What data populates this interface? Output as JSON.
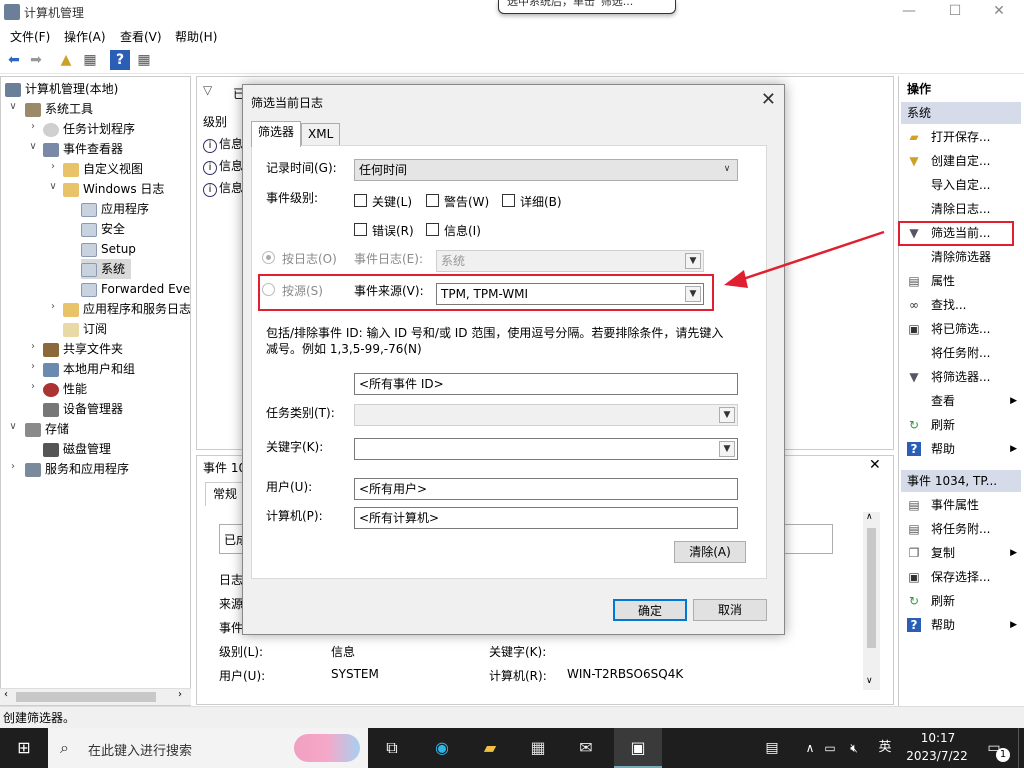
{
  "window": {
    "title": "计算机管理",
    "minimize": "—",
    "maximize": "☐",
    "close": "✕"
  },
  "tooltip": {
    "text": "选中系统后，单击“筛选...”"
  },
  "menu": [
    "文件(F)",
    "操作(A)",
    "查看(V)",
    "帮助(H)"
  ],
  "tree": {
    "items": [
      {
        "label": "计算机管理(本地)",
        "icon": "computer-management-icon"
      },
      {
        "label": "系统工具",
        "icon": "tools-icon"
      },
      {
        "label": "任务计划程序",
        "icon": "clock-icon"
      },
      {
        "label": "事件查看器",
        "icon": "event-viewer-icon"
      },
      {
        "label": "自定义视图",
        "icon": "folder-icon"
      },
      {
        "label": "Windows 日志",
        "icon": "folder-icon"
      },
      {
        "label": "应用程序",
        "icon": "log-icon"
      },
      {
        "label": "安全",
        "icon": "log-icon"
      },
      {
        "label": "Setup",
        "icon": "log-icon"
      },
      {
        "label": "系统",
        "icon": "log-icon"
      },
      {
        "label": "Forwarded Eve",
        "icon": "log-icon"
      },
      {
        "label": "应用程序和服务日志",
        "icon": "folder-icon"
      },
      {
        "label": "订阅",
        "icon": "subscription-icon"
      },
      {
        "label": "共享文件夹",
        "icon": "shared-folder-icon"
      },
      {
        "label": "本地用户和组",
        "icon": "users-icon"
      },
      {
        "label": "性能",
        "icon": "performance-icon"
      },
      {
        "label": "设备管理器",
        "icon": "device-manager-icon"
      },
      {
        "label": "存储",
        "icon": "storage-icon"
      },
      {
        "label": "磁盘管理",
        "icon": "disk-icon"
      },
      {
        "label": "服务和应用程序",
        "icon": "services-icon"
      }
    ]
  },
  "center_top": {
    "header_letter": "已",
    "column_level": "级别",
    "rows": [
      "信息",
      "信息",
      "信息"
    ]
  },
  "center_bottom": {
    "header": "事件 10",
    "tab": "常规",
    "box_text": "已成",
    "labels": [
      "日志",
      "来源",
      "事件"
    ],
    "level_label": "级别(L):",
    "level_value": "信息",
    "keyword_label": "关键字(K):",
    "user_label": "用户(U):",
    "user_value": "SYSTEM",
    "computer_label": "计算机(R):",
    "computer_value": "WIN-T2RBSO6SQ4K"
  },
  "actions": {
    "header": "操作",
    "section1": "系统",
    "items1": [
      {
        "label": "打开保存...",
        "icon": "open-folder-icon"
      },
      {
        "label": "创建自定...",
        "icon": "create-filter-icon"
      },
      {
        "label": "导入自定...",
        "icon": ""
      },
      {
        "label": "清除日志...",
        "icon": ""
      },
      {
        "label": "筛选当前...",
        "icon": "filter-icon"
      },
      {
        "label": "清除筛选器",
        "icon": ""
      },
      {
        "label": "属性",
        "icon": "properties-icon"
      },
      {
        "label": "查找...",
        "icon": "binoculars-icon"
      },
      {
        "label": "将已筛选...",
        "icon": "save-icon"
      },
      {
        "label": "将任务附...",
        "icon": ""
      },
      {
        "label": "将筛选器...",
        "icon": "attach-filter-icon"
      },
      {
        "label": "查看",
        "icon": ""
      },
      {
        "label": "刷新",
        "icon": "refresh-icon"
      },
      {
        "label": "帮助",
        "icon": "help-icon"
      }
    ],
    "section2": "事件 1034, TP...",
    "items2": [
      {
        "label": "事件属性",
        "icon": "event-properties-icon"
      },
      {
        "label": "将任务附...",
        "icon": "attach-task-icon"
      },
      {
        "label": "复制",
        "icon": "copy-icon"
      },
      {
        "label": "保存选择...",
        "icon": "save-icon"
      },
      {
        "label": "刷新",
        "icon": "refresh-icon"
      },
      {
        "label": "帮助",
        "icon": "help-icon"
      }
    ]
  },
  "status": "创建筛选器。",
  "dialog": {
    "title": "筛选当前日志",
    "tabs": [
      "筛选器",
      "XML"
    ],
    "logged_label": "记录时间(G):",
    "logged_value": "任何时间",
    "level_label": "事件级别:",
    "levels": [
      "关键(L)",
      "警告(W)",
      "详细(B)",
      "错误(R)",
      "信息(I)"
    ],
    "by_log_label": "按日志(O)",
    "event_log_label": "事件日志(E):",
    "event_log_value": "系统",
    "by_source_label": "按源(S)",
    "event_source_label": "事件来源(V):",
    "event_source_value": "TPM, TPM-WMI",
    "include_text_1": "包括/排除事件 ID: 输入 ID 号和/或 ID 范围，使用逗号分隔。若要排除条件，请先键入",
    "include_text_2": "减号。例如 1,3,5-99,-76(N)",
    "event_id_value": "<所有事件 ID>",
    "task_label": "任务类别(T):",
    "keywords_label": "关键字(K):",
    "user_label": "用户(U):",
    "user_value": "<所有用户>",
    "computer_label": "计算机(P):",
    "computer_value": "<所有计算机>",
    "clear_button": "清除(A)",
    "ok_button": "确定",
    "cancel_button": "取消"
  },
  "taskbar": {
    "search_placeholder": "在此键入进行搜索",
    "time": "10:17",
    "date": "2023/7/22",
    "ime": "英",
    "notification_count": "1"
  },
  "annotation_color": "#e02030"
}
